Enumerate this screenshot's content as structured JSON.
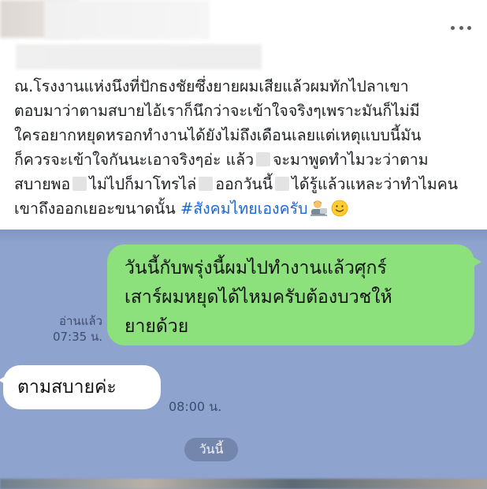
{
  "post": {
    "more_icon": "more-horizontal-icon",
    "lines": [
      "ณ.โรงงานแห่งนึงที่ปักธงชัยซึ่งยายผมเสียแล้วผมทักไปลาเขา",
      "ตอบมาว่าตามสบายไอ้เราก็นึกว่าจะเข้าใจจริงๆเพราะมันก็ไม่มี",
      "ใครอยากหยุดหรอกทำงานได้ยังไม่ถึงเดือนเลยแต่เหตุแบบนี้มัน"
    ],
    "line4_a": "ก็ควรจะเข้าใจกันนะเอาจริงๆอ่ะ แล้ว",
    "line4_b": "จะมาพูดทำไมวะว่าตาม",
    "line5_a": "สบายพอ",
    "line5_b": "ไม่ไปก็มาโทรไล่",
    "line5_c": "ออกวันนี้",
    "line5_d": "ได้รู้แล้วแหละว่าทำไมคน",
    "line6_a": "เขาถึงออกเยอะขนาดนั้น ",
    "hashtag": "#สังคมไทยเองครับ",
    "emojis": [
      "technologist-emoji",
      "smiling-face-emoji"
    ]
  },
  "chat": {
    "outgoing_lines": [
      "วันนี้กับพรุ่งนี้ผมไปทำงานแล้วศุกร์",
      "เสาร์ผมหยุดได้ไหมครับต้องบวชให้",
      "ยายด้วย"
    ],
    "read_label": "อ่านแล้ว",
    "read_time": "07:35 น.",
    "incoming_text": "ตามสบายค่ะ",
    "incoming_time": "08:00 น.",
    "date_divider": "วันนี้",
    "colors": {
      "background": "#8ea3cd",
      "outgoing_bubble": "#8de17c",
      "incoming_bubble": "#ffffff",
      "hashtag": "#1a67d6"
    }
  }
}
